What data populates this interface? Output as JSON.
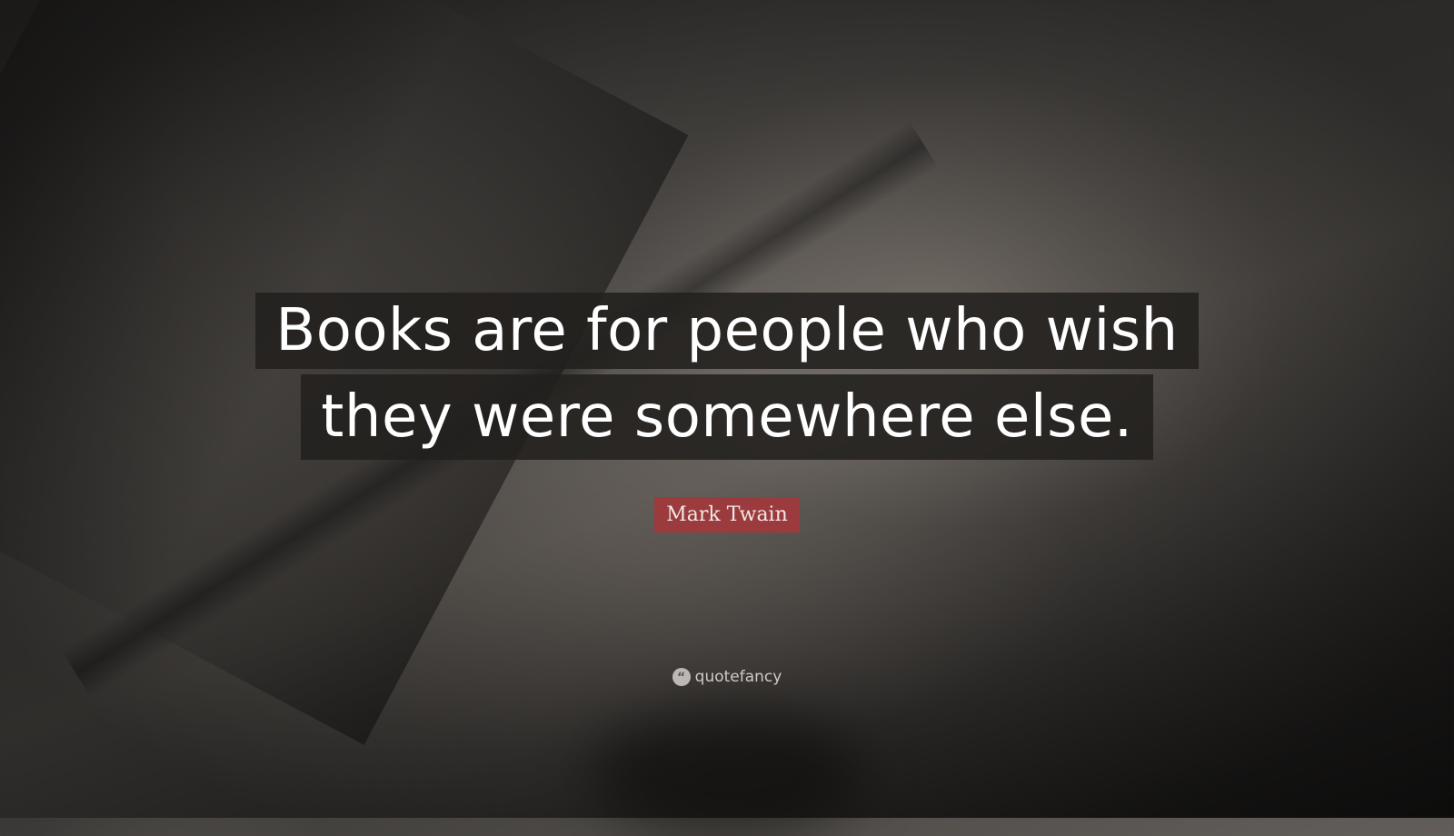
{
  "quote": {
    "lines": [
      "Books are for people who wish",
      "they were somewhere else."
    ]
  },
  "author": "Mark Twain",
  "brand": {
    "name": "quotefancy",
    "icon": "quote-mark-icon",
    "icon_glyph": "“"
  },
  "colors": {
    "author_badge": "#9b3b3d",
    "quote_background": "#222020"
  }
}
